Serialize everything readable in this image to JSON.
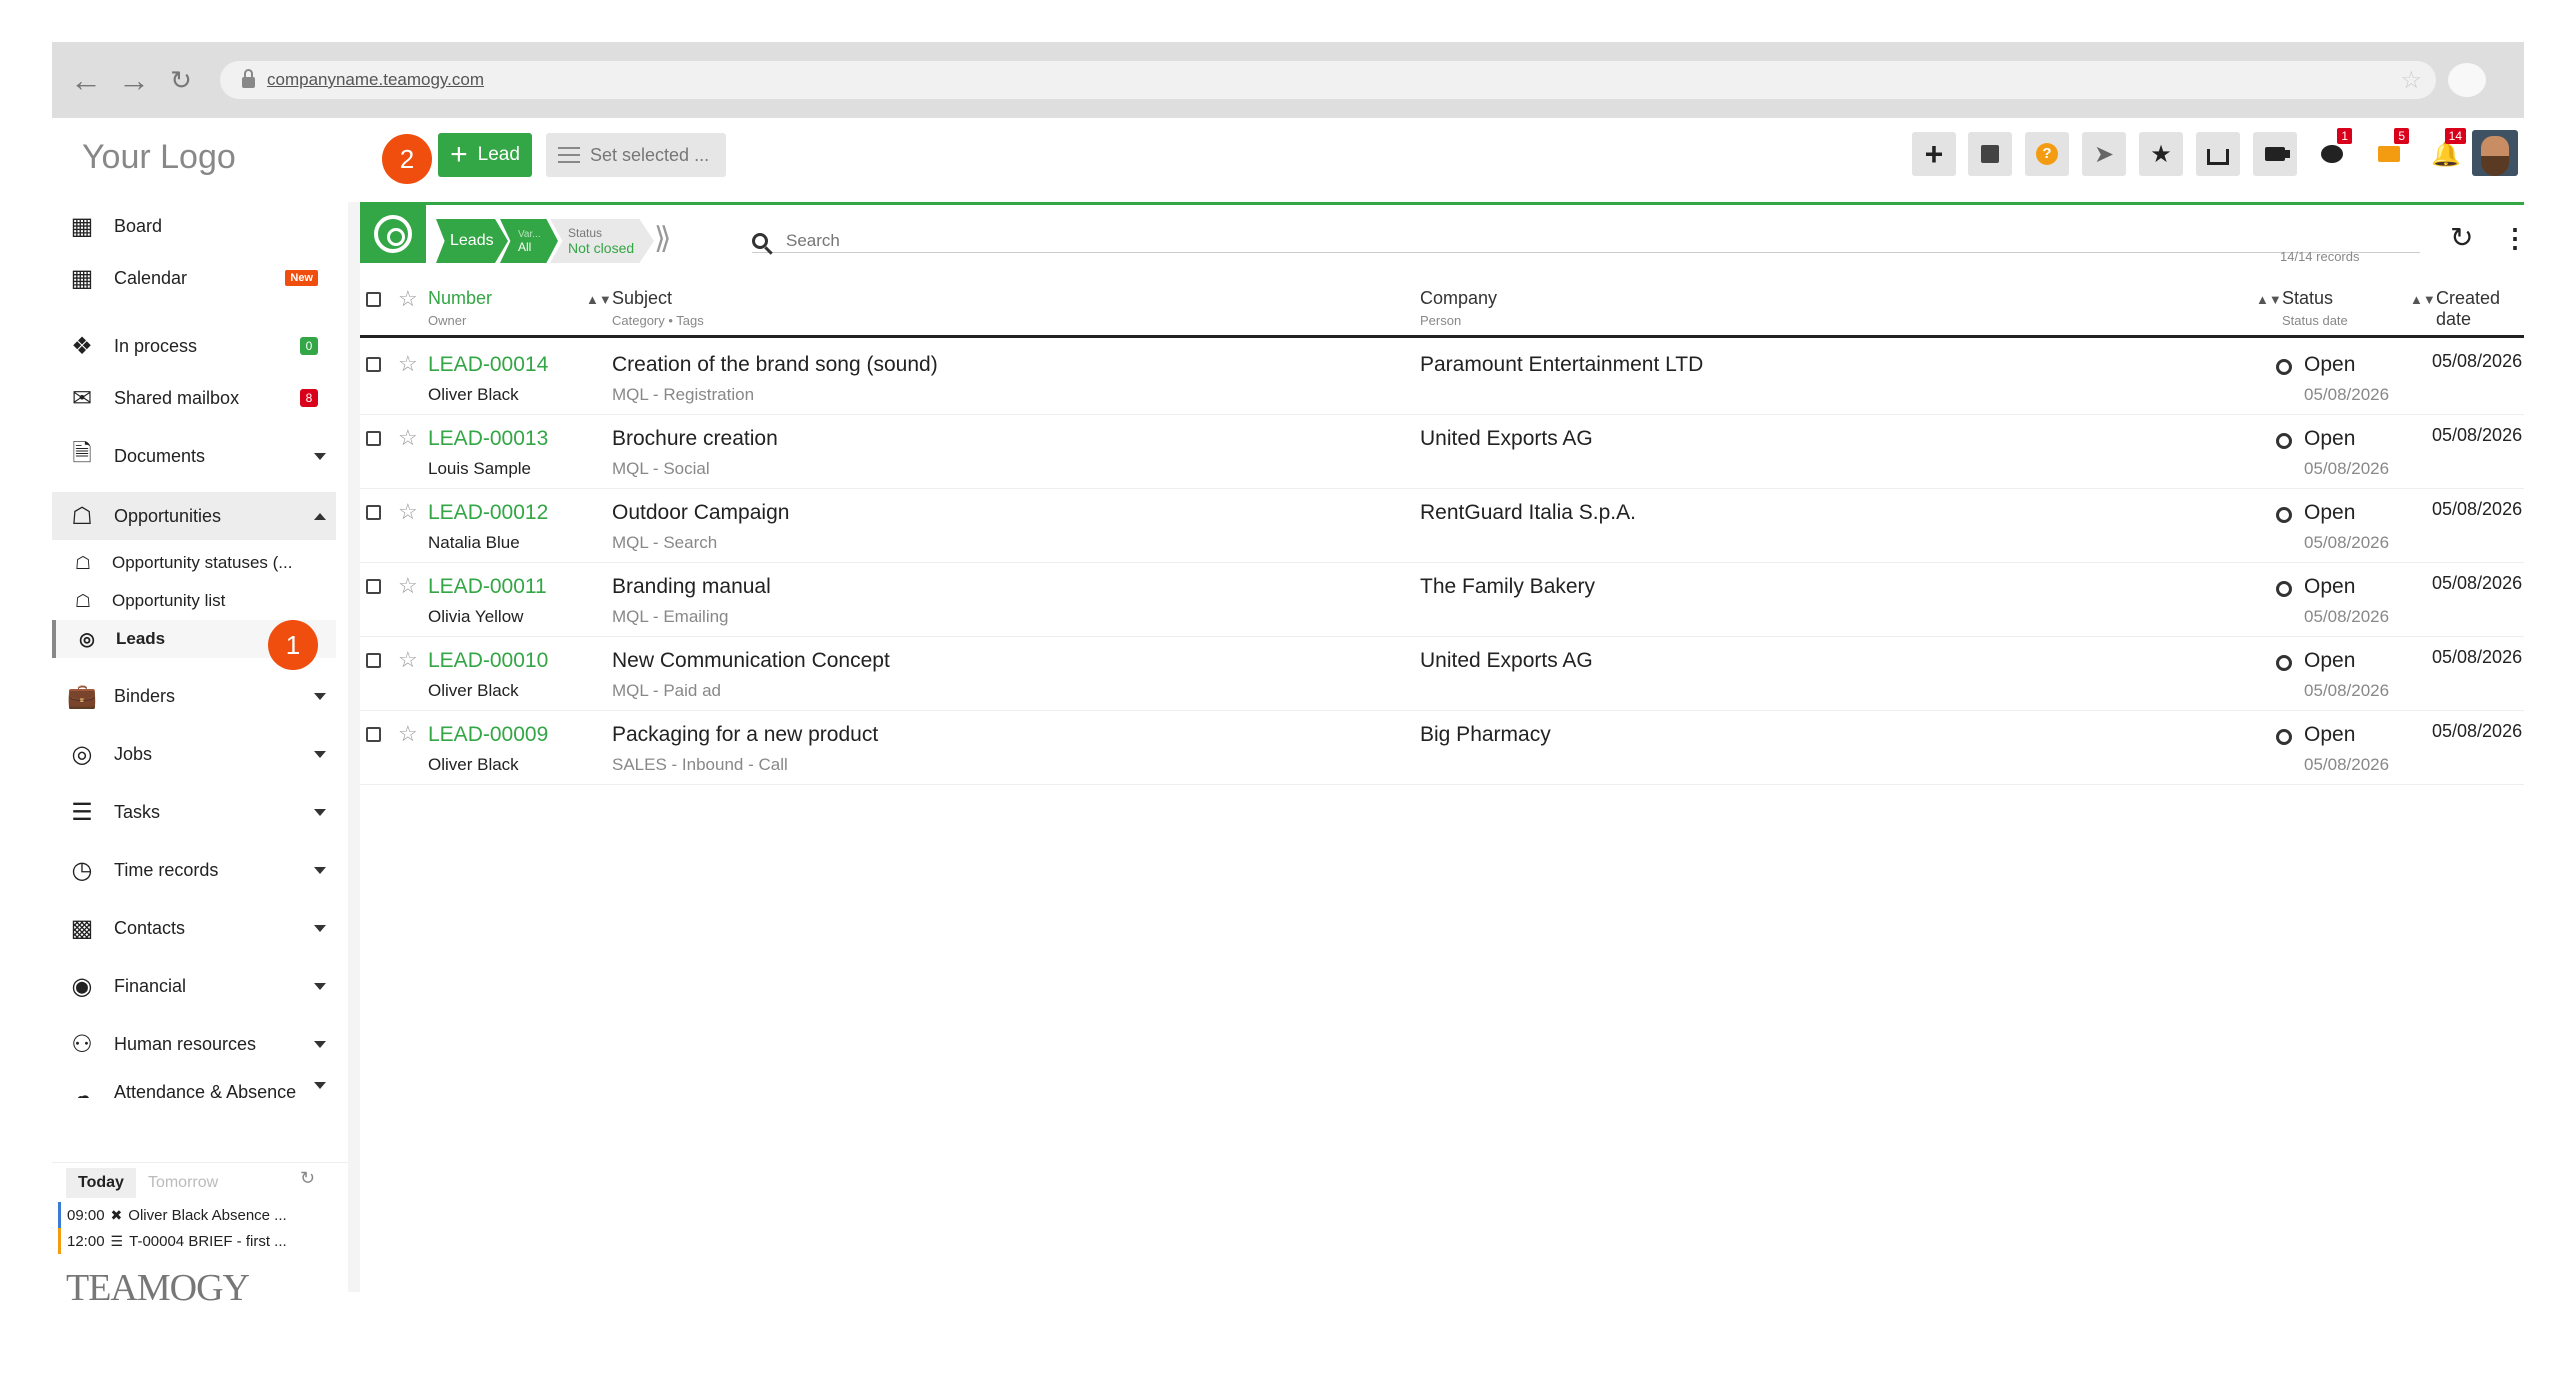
{
  "browser": {
    "url": "companyname.teamogy.com"
  },
  "app": {
    "logo": "Your Logo",
    "marker_one": "1",
    "marker_two": "2",
    "lead_button": "Lead",
    "set_selected": "Set selected ...",
    "badges": {
      "chat": "1",
      "messages": "5",
      "notifications": "14"
    }
  },
  "sidebar": {
    "items": [
      {
        "label": "Board",
        "icon": "grid-icon"
      },
      {
        "label": "Calendar",
        "icon": "calendar-icon",
        "tag": "New"
      },
      {
        "label": "In process",
        "icon": "process-icon",
        "count": "0"
      },
      {
        "label": "Shared mailbox",
        "icon": "mail-icon",
        "count": "8"
      },
      {
        "label": "Documents",
        "icon": "document-icon"
      },
      {
        "label": "Opportunities",
        "icon": "opportunity-icon"
      },
      {
        "label": "Binders",
        "icon": "briefcase-icon"
      },
      {
        "label": "Jobs",
        "icon": "target-icon"
      },
      {
        "label": "Tasks",
        "icon": "tasks-icon"
      },
      {
        "label": "Time records",
        "icon": "clock-icon"
      },
      {
        "label": "Contacts",
        "icon": "contact-icon"
      },
      {
        "label": "Financial",
        "icon": "dollar-icon"
      },
      {
        "label": "Human resources",
        "icon": "people-icon"
      },
      {
        "label": "Attendance & Absence",
        "icon": "attendance-icon"
      }
    ],
    "subitems": [
      {
        "label": "Opportunity statuses (..."
      },
      {
        "label": "Opportunity list"
      },
      {
        "label": "Leads"
      }
    ],
    "agenda_tabs": [
      "Today",
      "Tomorrow"
    ],
    "agenda": [
      {
        "time": "09:00",
        "text": "Oliver Black Absence ..."
      },
      {
        "time": "12:00",
        "text": "T-00004 BRIEF - first ..."
      }
    ],
    "brand_logo": "TEAMOGY"
  },
  "main": {
    "crumbs": {
      "leads": "Leads",
      "var_label": "Var...",
      "var_value": "All",
      "status_label": "Status",
      "status_value": "Not closed"
    },
    "search_placeholder": "Search",
    "records": "14/14 records",
    "columns": {
      "number": "Number",
      "owner": "Owner",
      "subject": "Subject",
      "category": "Category • Tags",
      "company": "Company",
      "person": "Person",
      "status": "Status",
      "status_date": "Status date",
      "created": "Created date"
    },
    "rows": [
      {
        "number": "LEAD-00014",
        "owner": "Oliver Black",
        "subject": "Creation of the brand song (sound)",
        "category": "MQL - Registration",
        "company": "Paramount Entertainment LTD",
        "status": "Open",
        "status_date": "05/08/2026",
        "created": "05/08/2026"
      },
      {
        "number": "LEAD-00013",
        "owner": "Louis Sample",
        "subject": "Brochure creation",
        "category": "MQL - Social",
        "company": "United Exports AG",
        "status": "Open",
        "status_date": "05/08/2026",
        "created": "05/08/2026"
      },
      {
        "number": "LEAD-00012",
        "owner": "Natalia Blue",
        "subject": "Outdoor Campaign",
        "category": "MQL - Search",
        "company": "RentGuard Italia S.p.A.",
        "status": "Open",
        "status_date": "05/08/2026",
        "created": "05/08/2026"
      },
      {
        "number": "LEAD-00011",
        "owner": "Olivia Yellow",
        "subject": "Branding manual",
        "category": "MQL - Emailing",
        "company": "The Family Bakery",
        "status": "Open",
        "status_date": "05/08/2026",
        "created": "05/08/2026"
      },
      {
        "number": "LEAD-00010",
        "owner": "Oliver Black",
        "subject": "New Communication Concept",
        "category": "MQL - Paid ad",
        "company": "United Exports AG",
        "status": "Open",
        "status_date": "05/08/2026",
        "created": "05/08/2026"
      },
      {
        "number": "LEAD-00009",
        "owner": "Oliver Black",
        "subject": "Packaging for a new product",
        "category": "SALES - Inbound - Call",
        "company": "Big Pharmacy",
        "status": "Open",
        "status_date": "05/08/2026",
        "created": "05/08/2026"
      }
    ]
  }
}
